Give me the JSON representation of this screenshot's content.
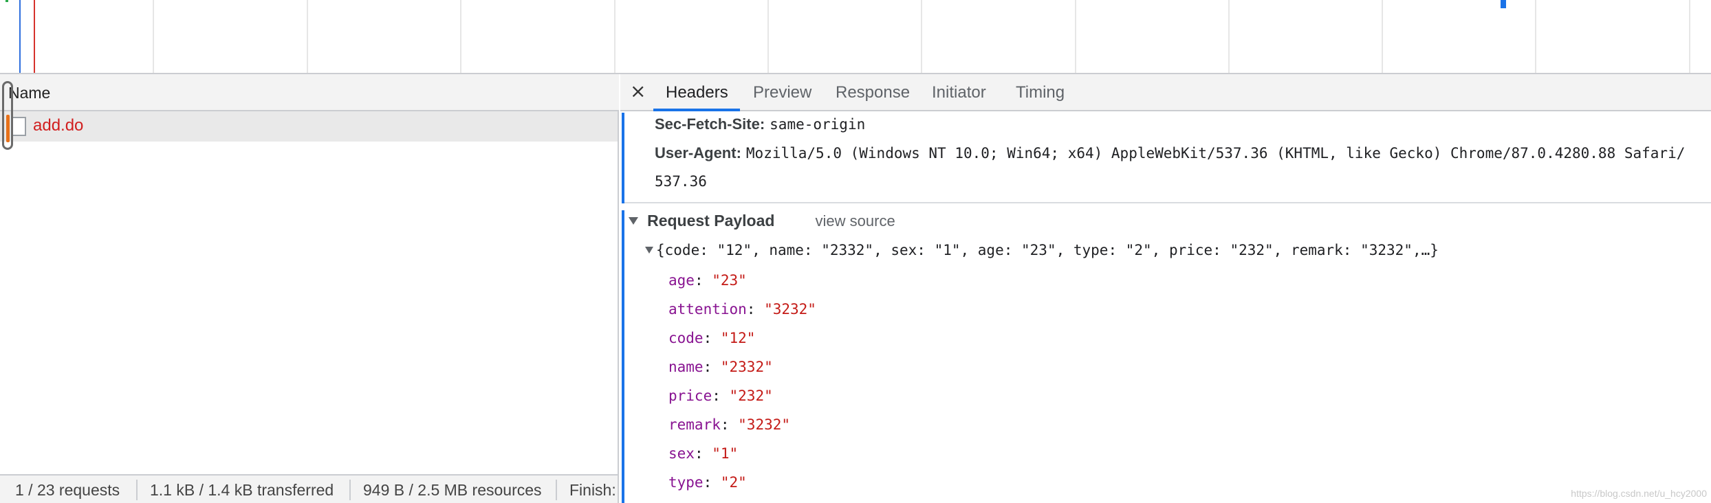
{
  "request_list": {
    "column_name": "Name",
    "rows": [
      {
        "name": "add.do"
      }
    ]
  },
  "status_bar": {
    "requests": "1 / 23 requests",
    "transferred": "1.1 kB / 1.4 kB transferred",
    "resources": "949 B / 2.5 MB resources",
    "finish": "Finish:"
  },
  "detail": {
    "close_glyph": "×",
    "tabs": [
      {
        "label": "Headers",
        "active": true
      },
      {
        "label": "Preview",
        "active": false
      },
      {
        "label": "Response",
        "active": false
      },
      {
        "label": "Initiator",
        "active": false
      },
      {
        "label": "Timing",
        "active": false
      }
    ],
    "headers": [
      {
        "key": "Sec-Fetch-Site:",
        "value": "same-origin"
      },
      {
        "key": "User-Agent:",
        "value": "Mozilla/5.0 (Windows NT 10.0; Win64; x64) AppleWebKit/537.36 (KHTML, like Gecko) Chrome/87.0.4280.88 Safari/",
        "wrap": "537.36"
      }
    ],
    "payload": {
      "title": "Request Payload",
      "view_source": "view source",
      "summary": "{code: \"12\", name: \"2332\", sex: \"1\", age: \"23\", type: \"2\", price: \"232\", remark: \"3232\",…}",
      "properties": [
        {
          "key": "age",
          "value": "\"23\""
        },
        {
          "key": "attention",
          "value": "\"3232\""
        },
        {
          "key": "code",
          "value": "\"12\""
        },
        {
          "key": "name",
          "value": "\"2332\""
        },
        {
          "key": "price",
          "value": "\"232\""
        },
        {
          "key": "remark",
          "value": "\"3232\""
        },
        {
          "key": "sex",
          "value": "\"1\""
        },
        {
          "key": "type",
          "value": "\"2\""
        }
      ]
    }
  },
  "watermark": "https://blog.csdn.net/u_hcy2000",
  "colors": {
    "accent": "#1a73e8",
    "error_red": "#d11f1f",
    "json_key": "#881391",
    "json_string": "#c41a16"
  }
}
